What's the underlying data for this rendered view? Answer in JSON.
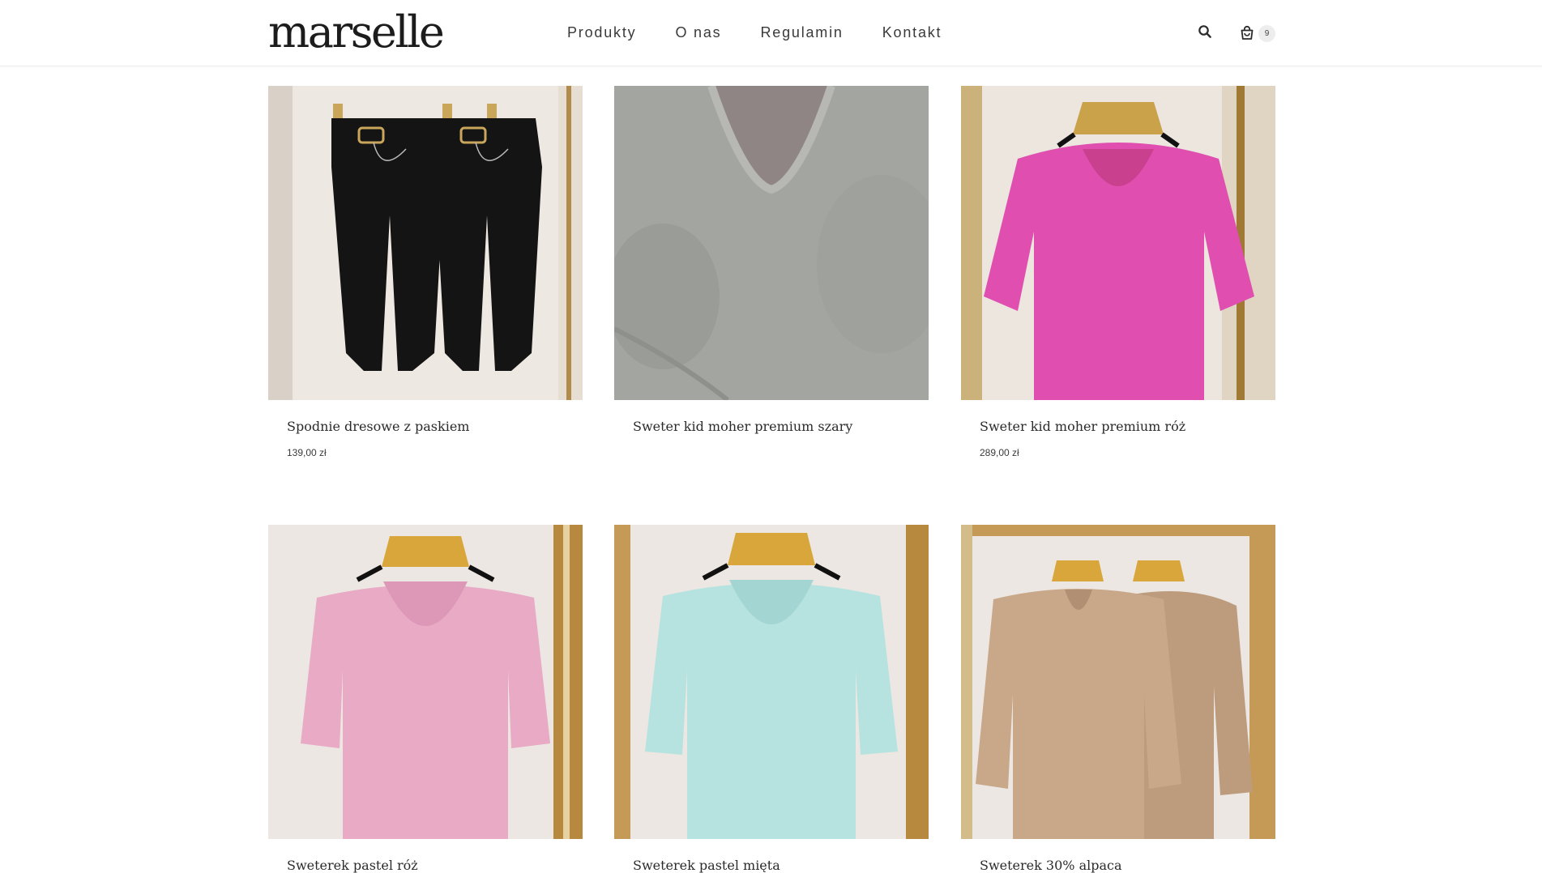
{
  "header": {
    "logo_text": "marselle",
    "nav": [
      "Produkty",
      "O nas",
      "Regulamin",
      "Kontakt"
    ],
    "cart_count": "9"
  },
  "products": [
    {
      "title": "Spodnie dresowe z paskiem",
      "price": "139,00 zł",
      "color": "#141414"
    },
    {
      "title": "Sweter kid moher premium szary",
      "price": "",
      "color": "#a3a5a1"
    },
    {
      "title": "Sweter kid moher premium róż",
      "price": "289,00 zł",
      "color": "#e04fb0"
    },
    {
      "title": "Sweterek pastel róż",
      "price": "",
      "color": "#e9aac6"
    },
    {
      "title": "Sweterek pastel mięta",
      "price": "",
      "color": "#b6e3df"
    },
    {
      "title": "Sweterek 30% alpaca",
      "price": "",
      "color": "#c9a88a"
    }
  ]
}
